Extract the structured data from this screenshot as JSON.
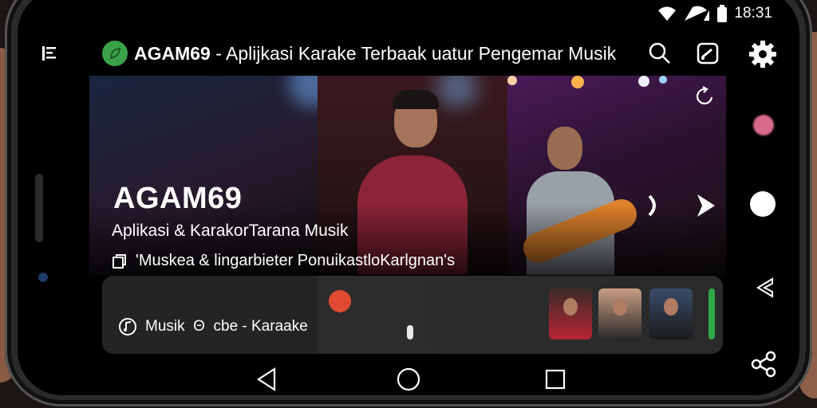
{
  "status_bar": {
    "time": "18:31",
    "icons": [
      "wifi-icon",
      "signal-icon",
      "battery-icon"
    ]
  },
  "app_bar": {
    "menu_icon": "menu-icon",
    "logo_icon": "leaf-logo-icon",
    "title_brand": "AGAM69",
    "title_rest": " - Aplijkasi Karake Terbaak uatur Pengemar Musik",
    "actions": [
      "search-icon",
      "cast-icon",
      "settings-icon"
    ]
  },
  "hero": {
    "title": "AGAM69",
    "subtitle": "Aplikasi & KarakorTarana Musik",
    "info_text": "'Muskea & lingarbieter PonuikastloKarlgnan's"
  },
  "player": {
    "label": "Musik  Θ  cbe - Karaake",
    "progress": 0.46
  },
  "colors": {
    "accent_green": "#3aa34a",
    "record_red": "#e14a32",
    "background": "#000000"
  },
  "nav": [
    "back-triangle-icon",
    "home-circle-icon",
    "recent-square-icon"
  ]
}
